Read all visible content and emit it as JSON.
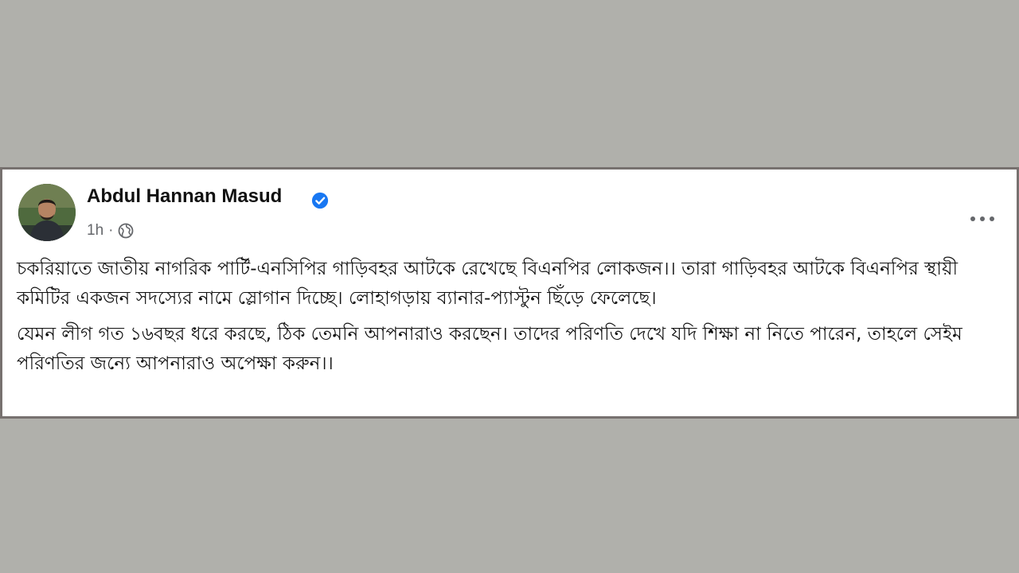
{
  "post": {
    "author_name": "Abdul Hannan Masud",
    "verified_icon": "verified-badge-icon",
    "time": "1h",
    "separator": "·",
    "audience_icon": "globe-icon",
    "more_icon": "more-options-icon",
    "paragraphs": [
      "চকরিয়াতে জাতীয় নাগরিক পার্টি-এনসিপির গাড়িবহর আটকে রেখেছে বিএনপির লোকজন।। তারা গাড়িবহর আটকে বিএনপির স্থায়ী কমিটির একজন সদস্যের নামে স্লোগান দিচ্ছে। লোহাগড়ায় ব্যানার-প্যাস্টুন ছিঁড়ে ফেলেছে।",
      "যেমন লীগ গত ১৬বছর ধরে করছে, ঠিক তেমনি আপনারাও করছেন। তাদের পরিণতি দেখে যদি শিক্ষা না নিতে পারেন, তাহলে সেইম পরিণতির জন্যে আপনারাও অপেক্ষা করুন।।"
    ]
  },
  "colors": {
    "page_background": "#b0b0ab",
    "card_border": "#77716f",
    "verified_blue": "#1877f2",
    "meta_gray": "#65676b"
  }
}
